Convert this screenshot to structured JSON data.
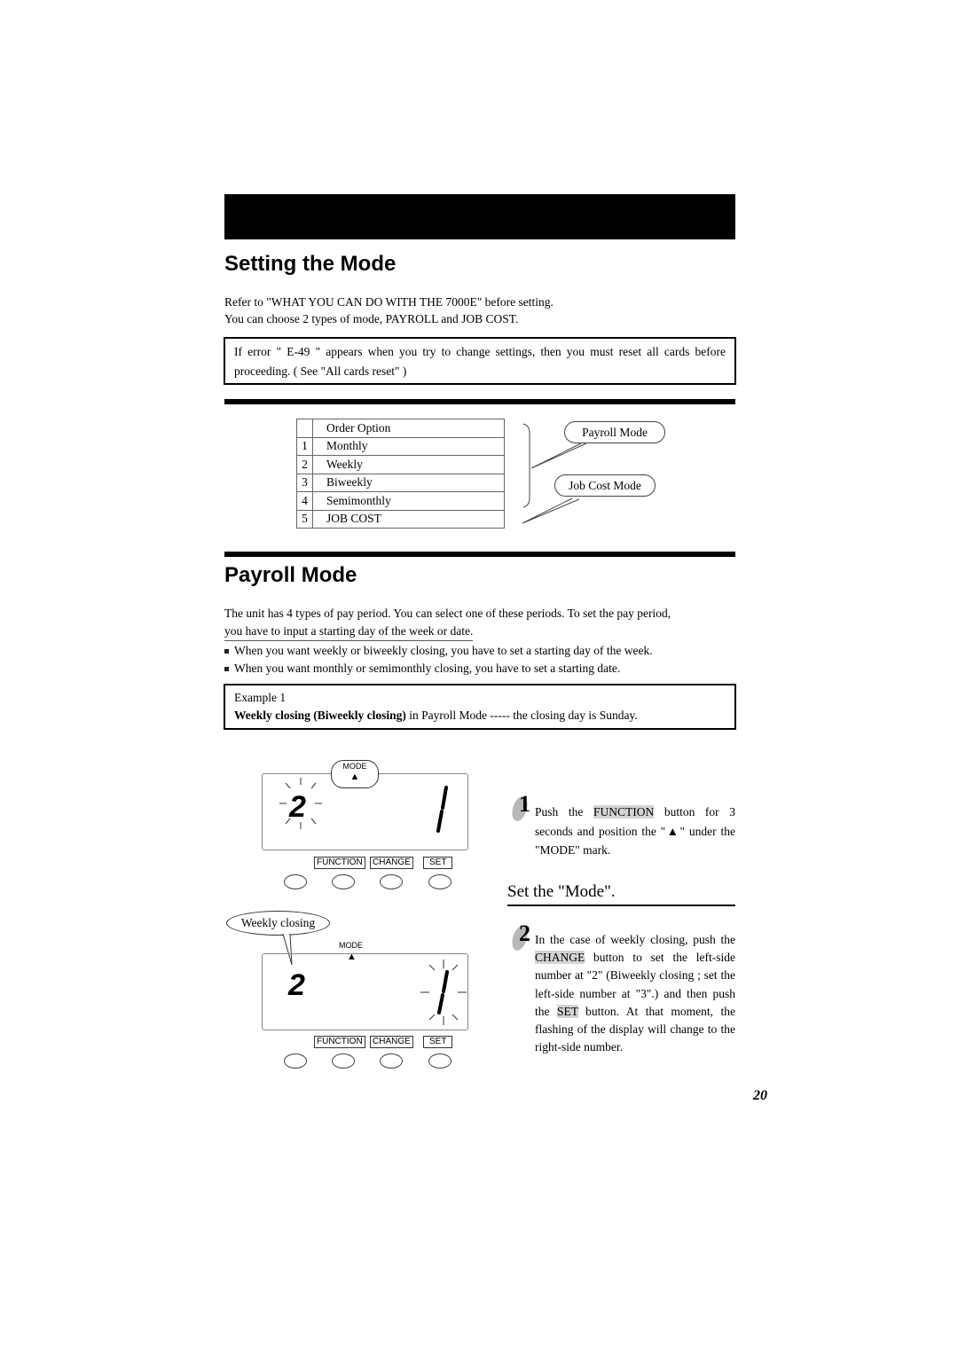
{
  "section": {
    "title": "Setting the Mode",
    "intro_lines": [
      "Refer to \"WHAT YOU CAN DO WITH THE 7000E\" before setting.",
      "You can choose 2 types of mode, PAYROLL and JOB COST."
    ],
    "warning": "If error \" E-49 \" appears when you try to change settings, then you must reset all cards before proceeding.  ( See \"All cards reset\" )"
  },
  "options_table": {
    "header": [
      "",
      "Order Option"
    ],
    "rows": [
      {
        "num": "1",
        "label": "Monthly"
      },
      {
        "num": "2",
        "label": "Weekly"
      },
      {
        "num": "3",
        "label": "Biweekly"
      },
      {
        "num": "4",
        "label": "Semimonthly"
      },
      {
        "num": "5",
        "label": "JOB COST"
      }
    ],
    "callouts": {
      "payroll": "Payroll Mode",
      "job_cost": "Job Cost Mode"
    }
  },
  "payroll": {
    "title": "Payroll Mode",
    "para_line1": "The unit has 4 types of pay period. You can select one of these periods. To set the pay period,",
    "para_line2": "you have to input a starting day of the week or date.",
    "bullets": [
      "When you want weekly or biweekly closing, you have to set a starting day of the week.",
      "When you want monthly or semimonthly closing, you have to set a starting date."
    ],
    "example": {
      "label": "Example 1",
      "bold1": "Weekly closing",
      "bold2": "(Biweekly closing)",
      "rest": " in Payroll Mode ----- the closing day is Sunday."
    }
  },
  "panel1": {
    "mode_label": "MODE",
    "left_digit": "2",
    "right_digit": "1",
    "buttons": [
      "FUNCTION",
      "CHANGE",
      "SET"
    ]
  },
  "panel2": {
    "callout": "Weekly closing",
    "mode_label": "MODE",
    "left_digit": "2",
    "right_digit": "1",
    "buttons": [
      "FUNCTION",
      "CHANGE",
      "SET"
    ]
  },
  "steps": {
    "subheading": "Set the \"Mode\".",
    "step1": {
      "num": "1",
      "pre": "Push the ",
      "hl": "FUNCTION",
      "post": " button for 3 seconds and position the \"▲\" under the \"MODE\" mark."
    },
    "step2": {
      "num": "2",
      "t1": "In the case of weekly closing, push the ",
      "hl1": "CHANGE",
      "t2": " button to set the left-side number at \"2\" (Biweekly closing ; set the left-side number at \"3\".) and then push the ",
      "hl2": "SET",
      "t3": " button. At that moment, the flashing of the display will change to the right-side number."
    }
  },
  "page_number": "20"
}
